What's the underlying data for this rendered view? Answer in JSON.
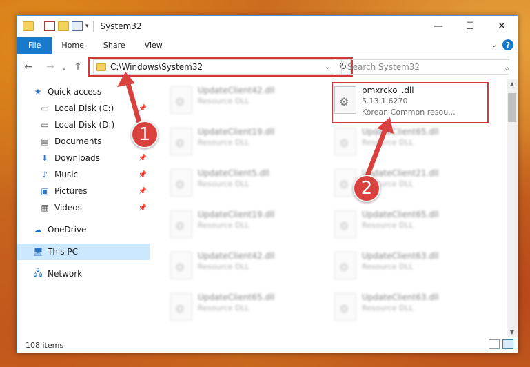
{
  "window": {
    "title": "System32",
    "controls": {
      "minimize": "—",
      "maximize": "☐",
      "close": "✕"
    }
  },
  "ribbon": {
    "tabs": [
      "File",
      "Home",
      "Share",
      "View"
    ],
    "help": "?"
  },
  "nav": {
    "back": "←",
    "forward": "→",
    "recent": "⌄",
    "up": "↑",
    "address": "C:\\Windows\\System32",
    "refresh": "↻",
    "search_placeholder": "Search System32"
  },
  "sidebar": {
    "items": [
      {
        "label": "Quick access",
        "icon": "star-icon"
      },
      {
        "label": "Local Disk (C:)",
        "icon": "drive-icon"
      },
      {
        "label": "Local Disk (D:)",
        "icon": "drive-icon"
      },
      {
        "label": "Documents",
        "icon": "documents-icon"
      },
      {
        "label": "Downloads",
        "icon": "download-icon"
      },
      {
        "label": "Music",
        "icon": "music-icon"
      },
      {
        "label": "Pictures",
        "icon": "pictures-icon"
      },
      {
        "label": "Videos",
        "icon": "videos-icon"
      },
      {
        "label": "OneDrive",
        "icon": "cloud-icon"
      },
      {
        "label": "This PC",
        "icon": "computer-icon"
      },
      {
        "label": "Network",
        "icon": "network-icon"
      }
    ]
  },
  "files": {
    "highlighted": {
      "name": "pmxrcko_.dll",
      "version": "5.13.1.6270",
      "description": "Korean Common resou..."
    },
    "left": [
      {
        "name": "UpdateClient42.dll",
        "type": "Resource DLL"
      },
      {
        "name": "UpdateClient19.dll",
        "type": "Resource DLL"
      },
      {
        "name": "UpdateClient5.dll",
        "type": "Resource DLL"
      },
      {
        "name": "UpdateClient19.dll",
        "type": "Resource DLL"
      },
      {
        "name": "UpdateClient42.dll",
        "type": "Resource DLL"
      },
      {
        "name": "UpdateClient65.dll",
        "type": "Resource DLL"
      }
    ],
    "right": [
      {
        "name": "UpdateClient65.dll",
        "type": "Resource DLL"
      },
      {
        "name": "UpdateClient21.dll",
        "type": "Resource DLL"
      },
      {
        "name": "UpdateClient65.dll",
        "type": "Resource DLL"
      },
      {
        "name": "UpdateClient63.dll",
        "type": "Resource DLL"
      },
      {
        "name": "UpdateClient63.dll",
        "type": "Resource DLL"
      }
    ]
  },
  "status": {
    "items": "108 items"
  },
  "annotations": {
    "step1": "1",
    "step2": "2"
  },
  "colors": {
    "accent": "#1979ca",
    "highlight": "#d7373a",
    "selected": "#cce8ff"
  }
}
